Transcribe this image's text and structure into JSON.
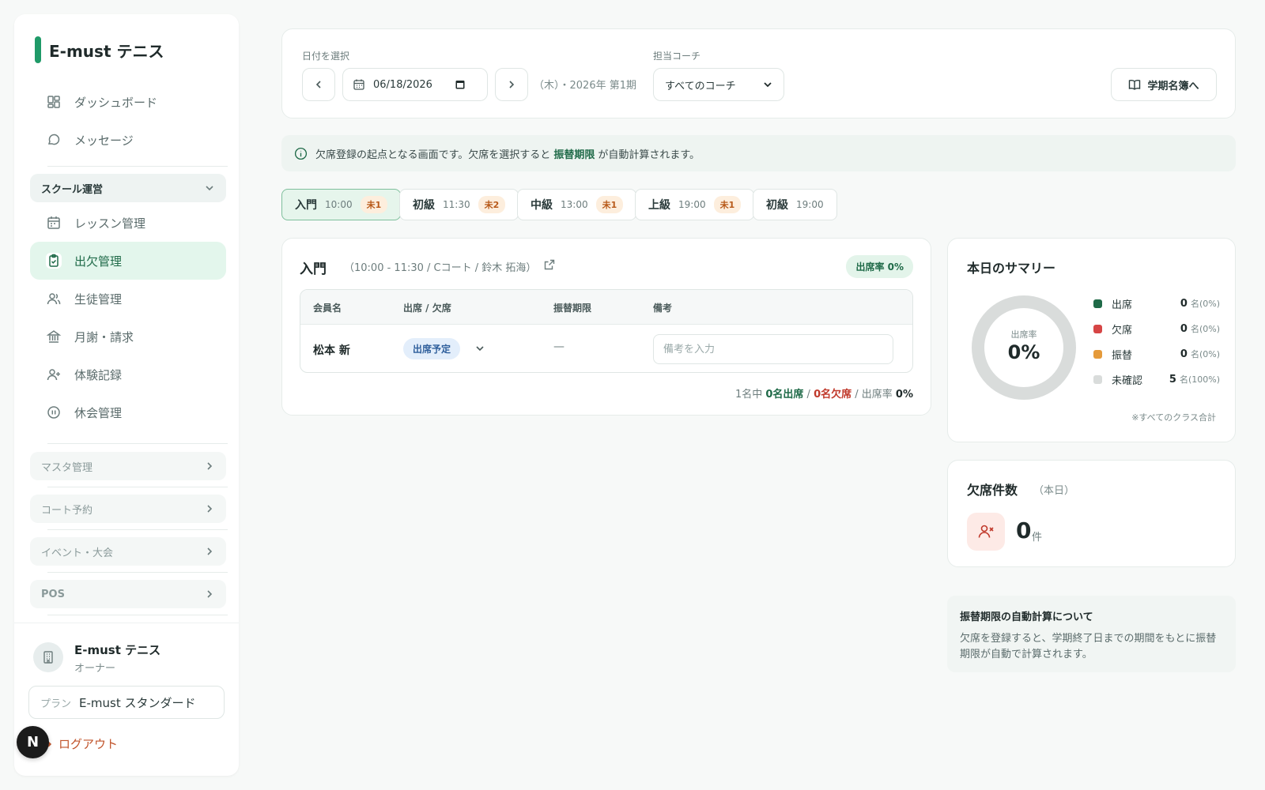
{
  "sidebar": {
    "brand": "E-must テニス",
    "items_top": [
      "ダッシュボード",
      "メッセージ"
    ],
    "section_school": "スクール運営",
    "items_school": [
      "レッスン管理",
      "出欠管理",
      "生徒管理",
      "月謝・請求",
      "体験記録",
      "休会管理"
    ],
    "active_item": "出欠管理",
    "collapsed_sections": [
      "マスタ管理",
      "コート予約",
      "イベント・大会",
      "POS"
    ],
    "user": {
      "name": "E-must テニス",
      "role": "オーナー"
    },
    "plan": {
      "label": "プラン",
      "value": "E-must スタンダード"
    },
    "logout": "ログアウト",
    "dev_badge": "N"
  },
  "filters": {
    "date_label": "日付を選択",
    "date_value": "06/18/2026",
    "week_info": "（木）・2026年 第1期",
    "coach_label": "担当コーチ",
    "coach_value": "すべてのコーチ",
    "roster_button": "学期名簿へ"
  },
  "info": {
    "text_before": "欠席登録の起点となる画面です。欠席を選択すると",
    "highlight": "振替期限",
    "text_after": "が自動計算されます。"
  },
  "class_tabs": [
    {
      "level": "入門",
      "time": "10:00",
      "badge": "未1",
      "active": true
    },
    {
      "level": "初級",
      "time": "11:30",
      "badge": "未2",
      "active": false
    },
    {
      "level": "中級",
      "time": "13:00",
      "badge": "未1",
      "active": false
    },
    {
      "level": "上級",
      "time": "19:00",
      "badge": "未1",
      "active": false
    },
    {
      "level": "初級",
      "time": "19:00",
      "badge": "",
      "active": false
    }
  ],
  "class_detail": {
    "title": "入門",
    "subtitle": "（10:00 - 11:30 / Cコート / 鈴木 拓海）",
    "rate_pill": "出席率 0%",
    "columns": [
      "会員名",
      "出席 / 欠席",
      "振替期限",
      "備考"
    ],
    "rows": [
      {
        "name": "松本 新",
        "status": "出席予定",
        "deadline": "—",
        "memo_placeholder": "備考を入力"
      }
    ],
    "tally": {
      "prefix": "1名中",
      "attend": "0名出席",
      "sep1": "/",
      "absent": "0名欠席",
      "sep2": "/ 出席率",
      "rate": "0%"
    }
  },
  "summary": {
    "title": "本日のサマリー",
    "donut_label": "出席率",
    "donut_value": "0%",
    "legend": [
      {
        "name": "出席",
        "value": "0",
        "unit": "名",
        "pct": "(0%)",
        "color": "#1f6a48"
      },
      {
        "name": "欠席",
        "value": "0",
        "unit": "名",
        "pct": "(0%)",
        "color": "#d64545"
      },
      {
        "name": "振替",
        "value": "0",
        "unit": "名",
        "pct": "(0%)",
        "color": "#e59a3a"
      },
      {
        "name": "未確認",
        "value": "5",
        "unit": "名",
        "pct": "(100%)",
        "color": "#d9dcdb"
      }
    ],
    "footnote": "※すべてのクラス合計"
  },
  "absence": {
    "title": "欠席件数",
    "sub": "（本日）",
    "value": "0",
    "unit": "件"
  },
  "note": {
    "title": "振替期限の自動計算について",
    "body": "欠席を登録すると、学期終了日までの期間をもとに振替期限が自動で計算されます。"
  },
  "chart_data": {
    "type": "pie",
    "categories": [
      "出席",
      "欠席",
      "振替",
      "未確認"
    ],
    "values": [
      0,
      0,
      0,
      5
    ]
  }
}
